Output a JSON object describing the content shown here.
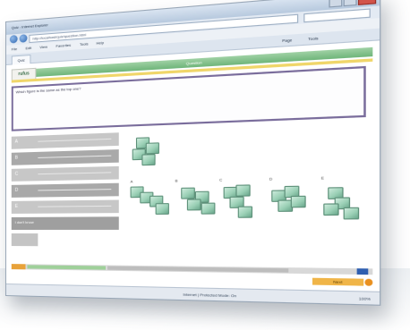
{
  "browser": {
    "title": "Quiz - Internet Explorer",
    "address": "http://localhost/quiz/question.html",
    "menu_items": [
      "File",
      "Edit",
      "View",
      "Favorites",
      "Tools",
      "Help"
    ],
    "tab_label": "Quiz",
    "commands": [
      "Page",
      "Tools"
    ]
  },
  "quiz": {
    "logo_text": "rufus",
    "header_text": "Question",
    "question_text": "Which figure is the same as the top one?",
    "answers": [
      "A",
      "B",
      "C",
      "D",
      "E"
    ],
    "answer_extra_label": "I don't know",
    "options": [
      "A",
      "B",
      "C",
      "D",
      "E"
    ],
    "next_label": "Next"
  },
  "status": {
    "zone": "Internet | Protected Mode: On",
    "zoom": "100%"
  },
  "colors": {
    "accent_green": "#6fb57a",
    "accent_yellow": "#f0d66a",
    "accent_orange": "#e8a23a",
    "question_border": "#7a6d9c"
  }
}
